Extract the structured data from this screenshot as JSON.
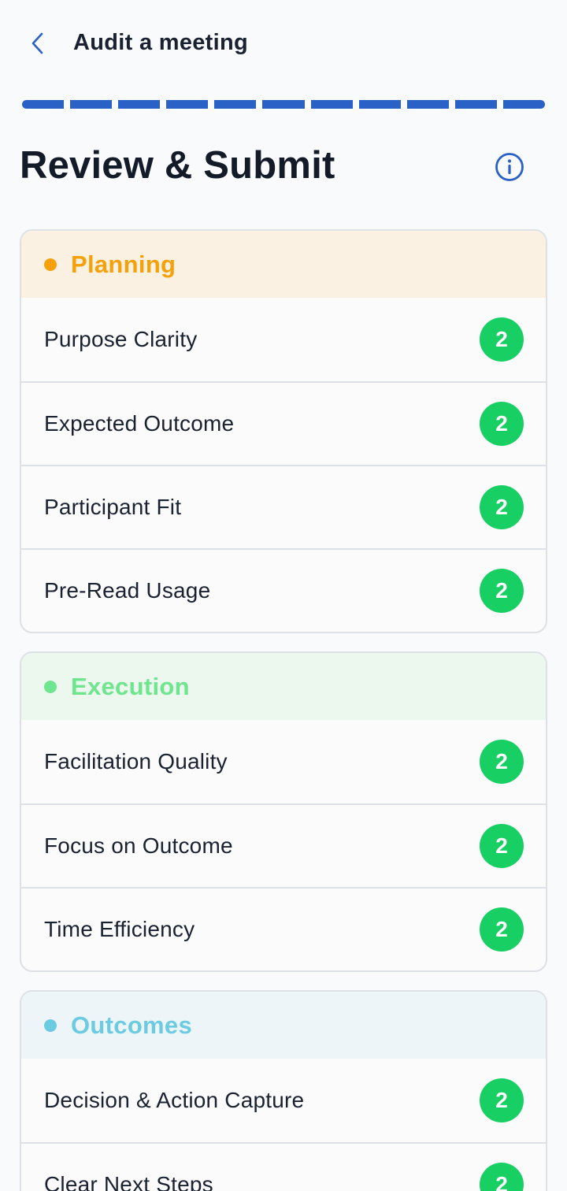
{
  "header": {
    "title": "Audit a meeting",
    "back_icon": "chevron-left-icon"
  },
  "progress": {
    "segments_total": 11,
    "segments_completed": 11,
    "color": "#2a61c7"
  },
  "page": {
    "title": "Review & Submit",
    "info_icon": "info-icon"
  },
  "sections": [
    {
      "label": "Planning",
      "color": "#f5a10b",
      "header_bg": "#fbf1e2",
      "items": [
        {
          "label": "Purpose Clarity",
          "score": "2"
        },
        {
          "label": "Expected Outcome",
          "score": "2"
        },
        {
          "label": "Participant Fit",
          "score": "2"
        },
        {
          "label": "Pre-Read Usage",
          "score": "2"
        }
      ]
    },
    {
      "label": "Execution",
      "color": "#6ee58e",
      "header_bg": "#ecf8ee",
      "items": [
        {
          "label": "Facilitation Quality",
          "score": "2"
        },
        {
          "label": "Focus on Outcome",
          "score": "2"
        },
        {
          "label": "Time Efficiency",
          "score": "2"
        }
      ]
    },
    {
      "label": "Outcomes",
      "color": "#6ccbe0",
      "header_bg": "#edf5f8",
      "items": [
        {
          "label": "Decision & Action Capture",
          "score": "2"
        },
        {
          "label": "Clear Next Steps",
          "score": "2"
        }
      ]
    }
  ],
  "colors": {
    "score_badge": "#18cf64",
    "accent": "#2a61c7"
  }
}
